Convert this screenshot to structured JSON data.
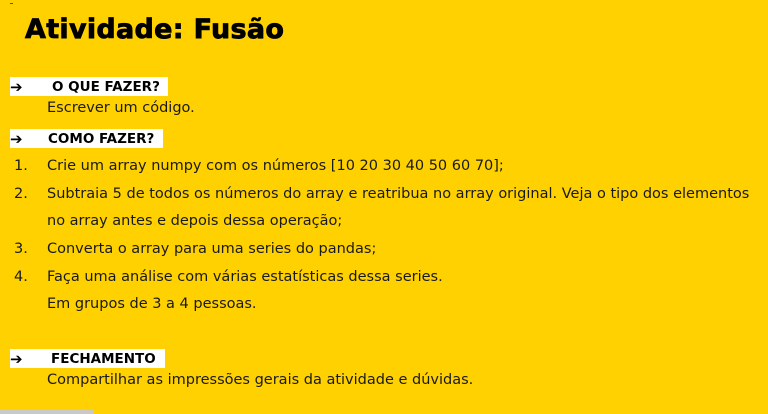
{
  "slide": {
    "title": "Atividade: Fusão",
    "sections": {
      "o_que_fazer": {
        "arrow": "➔",
        "label": "O QUE FAZER?",
        "text": "Escrever um código."
      },
      "como_fazer": {
        "arrow": "➔",
        "label": "COMO FAZER?",
        "steps": [
          {
            "num": "1.",
            "line1": "Crie um array numpy com os números [10 20 30 40 50 60 70];"
          },
          {
            "num": "2.",
            "line1": "Subtraia 5 de todos os números do array e reatribua no array original. Veja o tipo dos elementos",
            "line2": "no array antes e depois dessa operação;"
          },
          {
            "num": "3.",
            "line1": "Converta o array para uma series do pandas;"
          },
          {
            "num": "4.",
            "line1": "Faça uma análise com várias estatísticas dessa series."
          }
        ],
        "note": "Em grupos de 3 a 4 pessoas."
      },
      "fechamento": {
        "arrow": "➔",
        "label": "FECHAMENTO",
        "text": "Compartilhar as impressões gerais da atividade e dúvidas."
      }
    }
  }
}
